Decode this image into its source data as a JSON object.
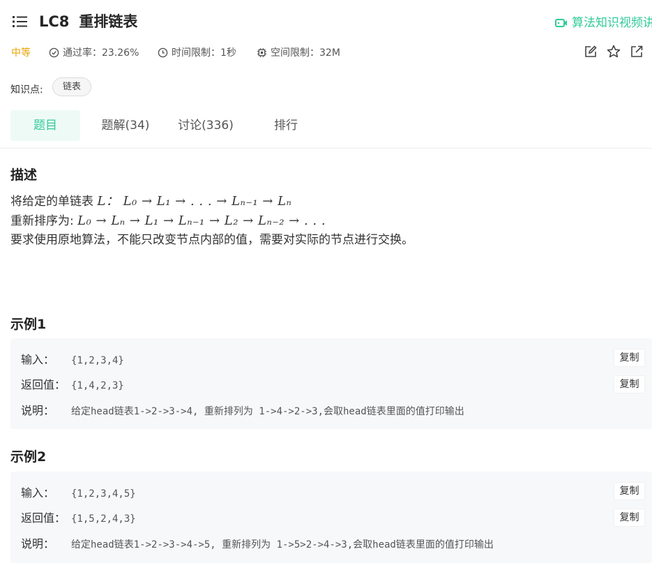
{
  "header": {
    "code": "LC8",
    "title": "重排链表",
    "video_link": "算法知识视频讲"
  },
  "meta": {
    "difficulty": "中等",
    "pass_rate": "通过率：23.26%",
    "time_limit": "时间限制：1秒",
    "memory_limit": "空间限制：32M",
    "icons": [
      "edit-icon",
      "star-icon",
      "external-link-icon"
    ]
  },
  "tags": {
    "label": "知识点:",
    "items": [
      "链表"
    ]
  },
  "tabs": [
    {
      "label": "题目",
      "active": true
    },
    {
      "label": "题解(34)",
      "active": false
    },
    {
      "label": "讨论(336)",
      "active": false
    },
    {
      "label": "排行",
      "active": false
    }
  ],
  "description": {
    "heading": "描述",
    "line1_text": "将给定的单链表",
    "line1_math": "L：  L₀ → L₁ → . . . → Lₙ₋₁ → Lₙ",
    "line2_text": "重新排序为:",
    "line2_math": "L₀ → Lₙ → L₁ → Lₙ₋₁ → L₂ → Lₙ₋₂ → . . .",
    "line3": "要求使用原地算法，不能只改变节点内部的值，需要对实际的节点进行交换。"
  },
  "examples": [
    {
      "heading": "示例1",
      "input_label": "输入：",
      "input": "{1,2,3,4}",
      "output_label": "返回值：",
      "output": "{1,4,2,3}",
      "explain_label": "说明：",
      "explain": "给定head链表1->2->3->4, 重新排列为 1->4->2->3,会取head链表里面的值打印输出",
      "copy_label": "复制"
    },
    {
      "heading": "示例2",
      "input_label": "输入：",
      "input": "{1,2,3,4,5}",
      "output_label": "返回值：",
      "output": "{1,5,2,4,3}",
      "explain_label": "说明：",
      "explain": "给定head链表1->2->3->4->5, 重新排列为 1->5>2->4->3,会取head链表里面的值打印输出",
      "copy_label": "复制"
    }
  ],
  "colors": {
    "accent": "#32ca99",
    "difficulty": "#e8a300",
    "tab_active_bg": "#eefaf6",
    "example_bg": "#f7f8fa"
  }
}
